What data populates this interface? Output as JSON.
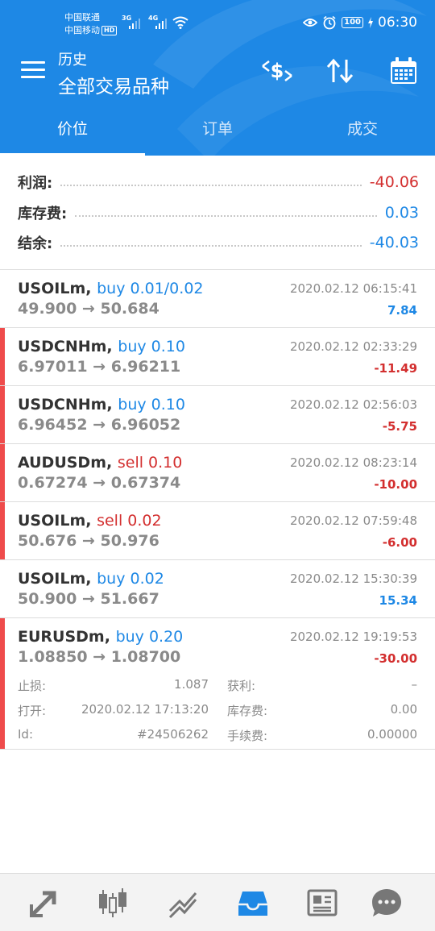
{
  "status": {
    "carrier1": "中国联通",
    "carrier2": "中国移动",
    "hd": "HD",
    "net1": "3G",
    "net2": "4G",
    "battery": "100",
    "time": "06:30"
  },
  "header": {
    "title_small": "历史",
    "title_big": "全部交易品种"
  },
  "tabs": [
    {
      "label": "价位"
    },
    {
      "label": "订单"
    },
    {
      "label": "成交"
    }
  ],
  "summary": [
    {
      "label": "利润:",
      "value": "-40.06",
      "color": "#d32f2f"
    },
    {
      "label": "库存费:",
      "value": "0.03",
      "color": "#1e88e5"
    },
    {
      "label": "结余:",
      "value": "-40.03",
      "color": "#1e88e5"
    }
  ],
  "deals": [
    {
      "symbol": "USOILm,",
      "type": "buy 0.01/0.02",
      "type_color": "#1e88e5",
      "prices": "49.900 → 50.684",
      "time": "2020.02.12 06:15:41",
      "profit": "7.84",
      "profit_color": "#1e88e5",
      "marked": false
    },
    {
      "symbol": "USDCNHm,",
      "type": "buy 0.10",
      "type_color": "#1e88e5",
      "prices": "6.97011 → 6.96211",
      "time": "2020.02.12 02:33:29",
      "profit": "-11.49",
      "profit_color": "#d32f2f",
      "marked": true
    },
    {
      "symbol": "USDCNHm,",
      "type": "buy 0.10",
      "type_color": "#1e88e5",
      "prices": "6.96452 → 6.96052",
      "time": "2020.02.12 02:56:03",
      "profit": "-5.75",
      "profit_color": "#d32f2f",
      "marked": true
    },
    {
      "symbol": "AUDUSDm,",
      "type": "sell 0.10",
      "type_color": "#d32f2f",
      "prices": "0.67274 → 0.67374",
      "time": "2020.02.12 08:23:14",
      "profit": "-10.00",
      "profit_color": "#d32f2f",
      "marked": true
    },
    {
      "symbol": "USOILm,",
      "type": "sell 0.02",
      "type_color": "#d32f2f",
      "prices": "50.676 → 50.976",
      "time": "2020.02.12 07:59:48",
      "profit": "-6.00",
      "profit_color": "#d32f2f",
      "marked": true
    },
    {
      "symbol": "USOILm,",
      "type": "buy 0.02",
      "type_color": "#1e88e5",
      "prices": "50.900 → 51.667",
      "time": "2020.02.12 15:30:39",
      "profit": "15.34",
      "profit_color": "#1e88e5",
      "marked": false
    },
    {
      "symbol": "EURUSDm,",
      "type": "buy 0.20",
      "type_color": "#1e88e5",
      "prices": "1.08850 → 1.08700",
      "time": "2020.02.12 19:19:53",
      "profit": "-30.00",
      "profit_color": "#d32f2f",
      "marked": true
    }
  ],
  "expanded": {
    "sl_label": "止损:",
    "sl_value": "1.087",
    "tp_label": "获利:",
    "tp_value": "–",
    "open_label": "打开:",
    "open_value": "2020.02.12 17:13:20",
    "swap_label": "库存费:",
    "swap_value": "0.00",
    "id_label": "Id:",
    "id_value": "#24506262",
    "fee_label": "手续费:",
    "fee_value": "0.00000"
  },
  "bottom_nav": [
    {
      "icon": "trade-arrows-icon"
    },
    {
      "icon": "candlestick-chart-icon"
    },
    {
      "icon": "line-chart-icon"
    },
    {
      "icon": "history-inbox-icon",
      "active": true
    },
    {
      "icon": "news-icon"
    },
    {
      "icon": "chat-bubble-icon"
    }
  ],
  "colors": {
    "accent": "#1e88e5",
    "loss": "#d32f2f",
    "marker": "#ef4b4b"
  }
}
